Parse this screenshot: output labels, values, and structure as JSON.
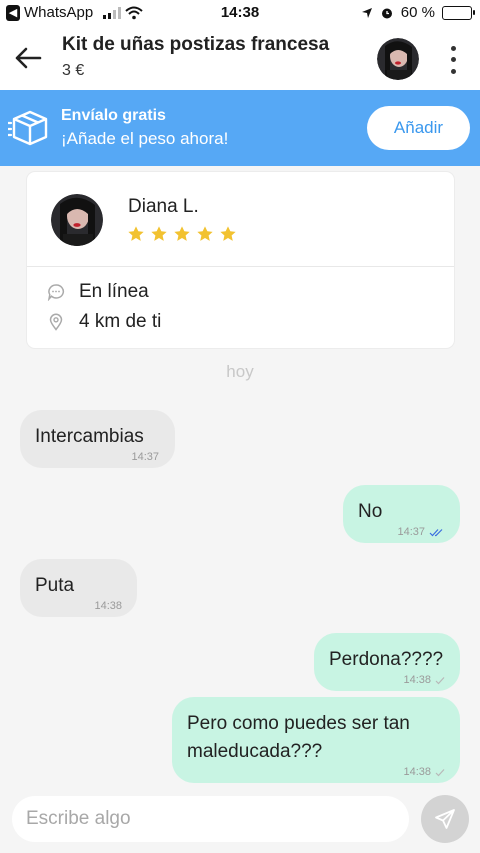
{
  "status_bar": {
    "carrier_back": "WhatsApp",
    "time": "14:38",
    "battery": "60 %",
    "battery_level": 0.6
  },
  "header": {
    "title": "Kit de uñas postizas francesa",
    "price": "3 €"
  },
  "banner": {
    "title": "Envíalo gratis",
    "subtitle": "¡Añade el peso ahora!",
    "button_label": "Añadir",
    "color": "#56a8f5"
  },
  "profile": {
    "name": "Diana L.",
    "rating": 5,
    "status": "En línea",
    "distance": "4 km de ti",
    "star_color": "#f2c230"
  },
  "chat": {
    "day_label": "hoy",
    "messages": [
      {
        "direction": "in",
        "text": "Intercambias",
        "time": "14:37"
      },
      {
        "direction": "out",
        "text": "No",
        "time": "14:37",
        "receipt": "read"
      },
      {
        "direction": "in",
        "text": "Puta",
        "time": "14:38"
      },
      {
        "direction": "out",
        "text": "Perdona????",
        "time": "14:38",
        "receipt": "sent"
      },
      {
        "direction": "out",
        "text": "Pero como puedes ser tan\nmaleducada???",
        "time": "14:38",
        "receipt": "sent"
      }
    ]
  },
  "composer": {
    "placeholder": "Escribe algo"
  },
  "colors": {
    "incoming_bubble": "#e9e9e9",
    "outgoing_bubble": "#c8f4e3",
    "read_check": "#3b6ee0"
  }
}
